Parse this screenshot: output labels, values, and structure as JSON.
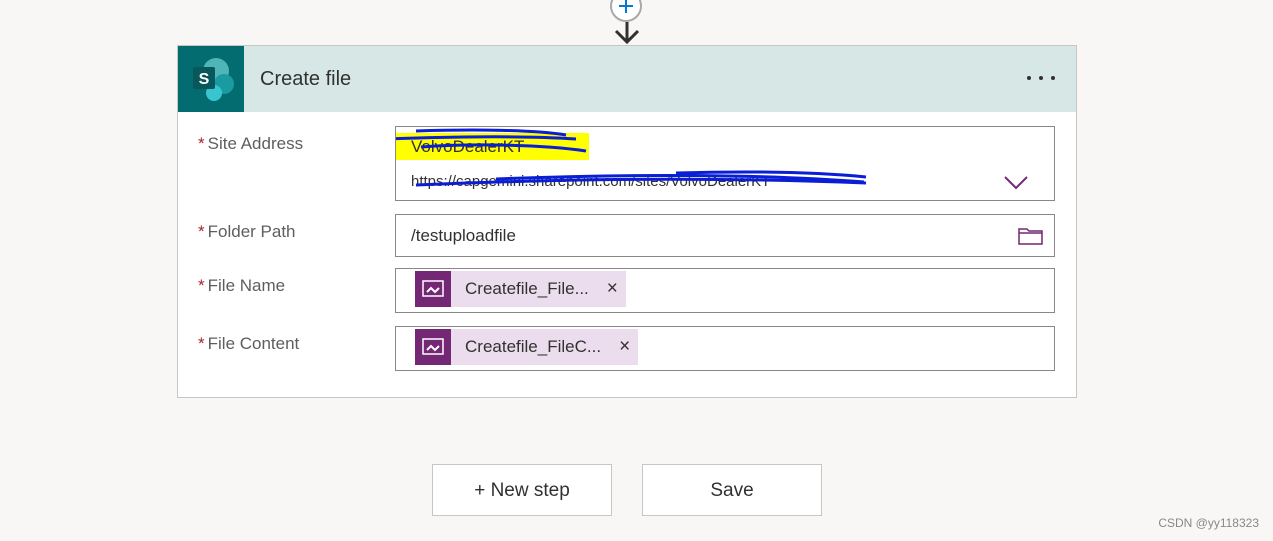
{
  "card": {
    "title": "Create file",
    "more_label": "..."
  },
  "fields": {
    "site_address": {
      "label": "Site Address",
      "required_mark": "*",
      "value_name": "VolvoDealerKT",
      "value_url": "https://capgemini.sharepoint.com/sites/VolvoDealerKT"
    },
    "folder_path": {
      "label": "Folder Path",
      "required_mark": "*",
      "value": "/testuploadfile"
    },
    "file_name": {
      "label": "File Name",
      "required_mark": "*",
      "token": "Createfile_File..."
    },
    "file_content": {
      "label": "File Content",
      "required_mark": "*",
      "token": "Createfile_FileC..."
    }
  },
  "token_close": "×",
  "buttons": {
    "new_step": "+ New step",
    "save": "Save"
  },
  "watermark": "CSDN @yy118323",
  "colors": {
    "header_bg": "#d6e7e6",
    "sharepoint": "#036c70",
    "powerapps_token": "#742774",
    "token_bg": "#ebdded",
    "required": "#a4262c",
    "highlight": "#ffff00",
    "scribble": "#0a1ed6"
  }
}
